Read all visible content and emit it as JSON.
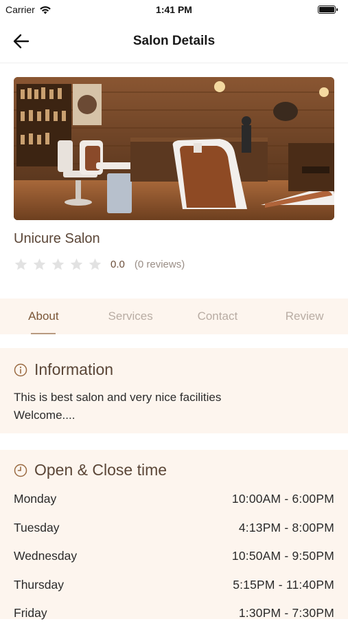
{
  "status_bar": {
    "carrier": "Carrier",
    "time": "1:41 PM"
  },
  "header": {
    "title": "Salon Details",
    "back_icon": "arrow-left-icon"
  },
  "salon": {
    "name": "Unicure Salon",
    "rating_value": "0.0",
    "review_count": "(0 reviews)",
    "stars_filled": 0,
    "stars_total": 5
  },
  "tabs": [
    {
      "label": "About",
      "active": true
    },
    {
      "label": "Services",
      "active": false
    },
    {
      "label": "Contact",
      "active": false
    },
    {
      "label": "Review",
      "active": false
    }
  ],
  "information": {
    "title": "Information",
    "icon": "info-icon",
    "line1": "This is best salon and very nice facilities",
    "line2": "Welcome...."
  },
  "hours": {
    "title": "Open & Close time",
    "icon": "clock-icon",
    "rows": [
      {
        "day": "Monday",
        "time": "10:00AM - 6:00PM"
      },
      {
        "day": "Tuesday",
        "time": "4:13PM - 8:00PM"
      },
      {
        "day": "Wednesday",
        "time": "10:50AM - 9:50PM"
      },
      {
        "day": "Thursday",
        "time": "5:15PM - 11:40PM"
      },
      {
        "day": "Friday",
        "time": "1:30PM - 7:30PM"
      }
    ]
  },
  "colors": {
    "accent": "#7a5637",
    "card_bg": "#fdf5ee",
    "star_empty": "#e2e2e2"
  }
}
